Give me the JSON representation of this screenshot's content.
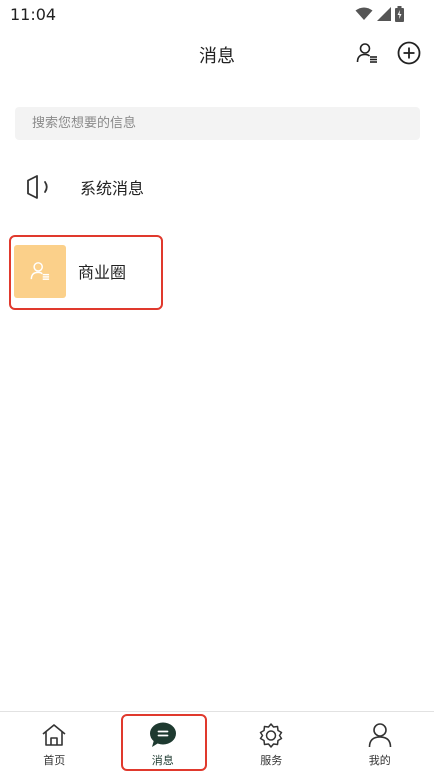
{
  "status_bar": {
    "time": "11:04"
  },
  "header": {
    "title": "消息"
  },
  "search": {
    "placeholder": "搜索您想要的信息"
  },
  "list": [
    {
      "label": "系统消息",
      "icon": "speaker-icon"
    },
    {
      "label": "商业圈",
      "icon": "contacts-icon"
    }
  ],
  "bottom_nav": [
    {
      "label": "首页",
      "icon": "home-icon"
    },
    {
      "label": "消息",
      "icon": "chat-bubble-icon",
      "active": true
    },
    {
      "label": "服务",
      "icon": "gear-icon"
    },
    {
      "label": "我的",
      "icon": "person-icon"
    }
  ],
  "colors": {
    "accent": "#1e3a30",
    "avatar_bg": "#fbd08a",
    "highlight": "#e0392d"
  }
}
